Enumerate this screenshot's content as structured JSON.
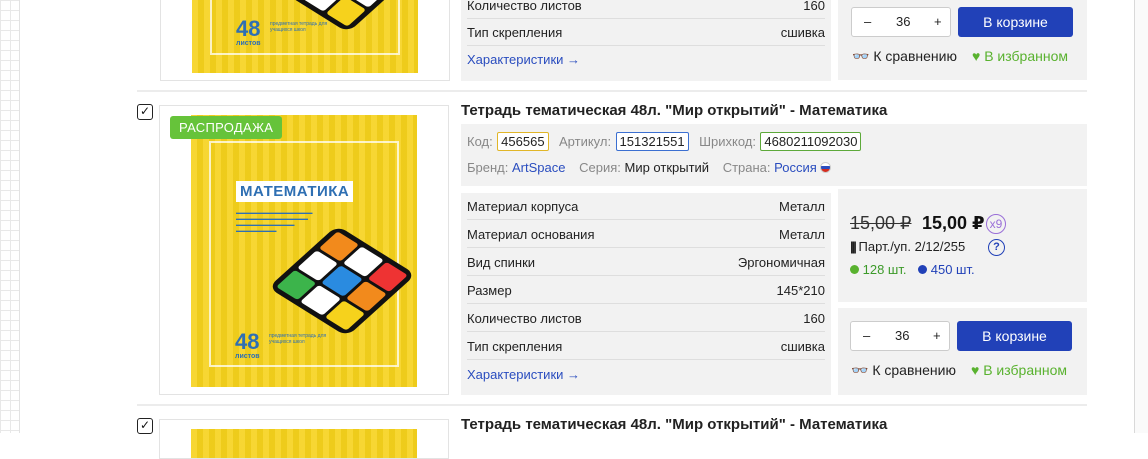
{
  "colors": {
    "accent": "#2141b8",
    "sale_badge": "#66c33a",
    "favorite": "#59b22f",
    "cover": "#f6d21c"
  },
  "top_item": {
    "specs": [
      {
        "label": "Количество листов",
        "value": "160"
      },
      {
        "label": "Тип скрепления",
        "value": "сшивка"
      }
    ],
    "characteristics_link": "Характеристики →",
    "quantity": "36",
    "cart_button": "В корзине",
    "compare_label": "К сравнению",
    "favorite_label": "В избранном"
  },
  "item": {
    "badge": "РАСПРОДАЖА",
    "title": "Тетрадь тематическая 48л. \"Мир открытий\" - Математика",
    "code_label": "Код:",
    "code": "456565",
    "article_label": "Артикул:",
    "article": "151321551",
    "barcode_label": "Шрихкод:",
    "barcode": "4680211092030",
    "brand_label": "Бренд:",
    "brand": "ArtSpace",
    "series_label": "Серия:",
    "series": "Мир открытий",
    "country_label": "Страна:",
    "country": "Россия",
    "specs": [
      {
        "label": "Материал корпуса",
        "value": "Металл"
      },
      {
        "label": "Материал основания",
        "value": "Металл"
      },
      {
        "label": "Вид спинки",
        "value": "Эргономичная"
      },
      {
        "label": "Размер",
        "value": "145*210"
      },
      {
        "label": "Количество листов",
        "value": "160"
      },
      {
        "label": "Тип скрепления",
        "value": "сшивка"
      }
    ],
    "characteristics_link": "Характеристики →",
    "old_price": "15,00 ₽",
    "price": "15,00 ₽",
    "multiplier": "x9",
    "pack_label": "Парт./уп. 2/12/255",
    "stock_green": "128 шт.",
    "stock_blue": "450 шт.",
    "quantity": "36",
    "cart_button": "В корзине",
    "compare_label": "К сравнению",
    "favorite_label": "В избранном"
  },
  "cover": {
    "subject": "МАТЕМАТИКА",
    "count": "48",
    "count_word": "листов",
    "small_lines": "предметная тетрадь для учащихся школ"
  },
  "next_item": {
    "title": "Тетрадь тематическая 48л. \"Мир открытий\" - Математика"
  }
}
